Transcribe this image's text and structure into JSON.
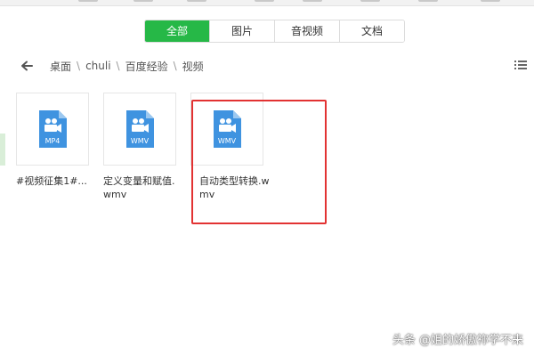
{
  "tabs": [
    {
      "label": "全部",
      "active": true
    },
    {
      "label": "图片",
      "active": false
    },
    {
      "label": "音视频",
      "active": false
    },
    {
      "label": "文档",
      "active": false
    }
  ],
  "breadcrumb": [
    "桌面",
    "chuli",
    "百度经验",
    "视频"
  ],
  "files": [
    {
      "name": "#视频征集1#...",
      "format": "MP4"
    },
    {
      "name": "定义变量和赋值.wmv",
      "format": "WMV"
    },
    {
      "name": "自动类型转换.wmv",
      "format": "WMV"
    }
  ],
  "icons": {
    "back": "back-arrow-icon",
    "list_view": "list-view-icon",
    "video_file": "video-file-icon"
  },
  "colors": {
    "accent": "#26b847",
    "highlight": "#e23232",
    "file_icon": "#3f93e0"
  },
  "watermark": "头条 @姐的娇傲祢学不来"
}
